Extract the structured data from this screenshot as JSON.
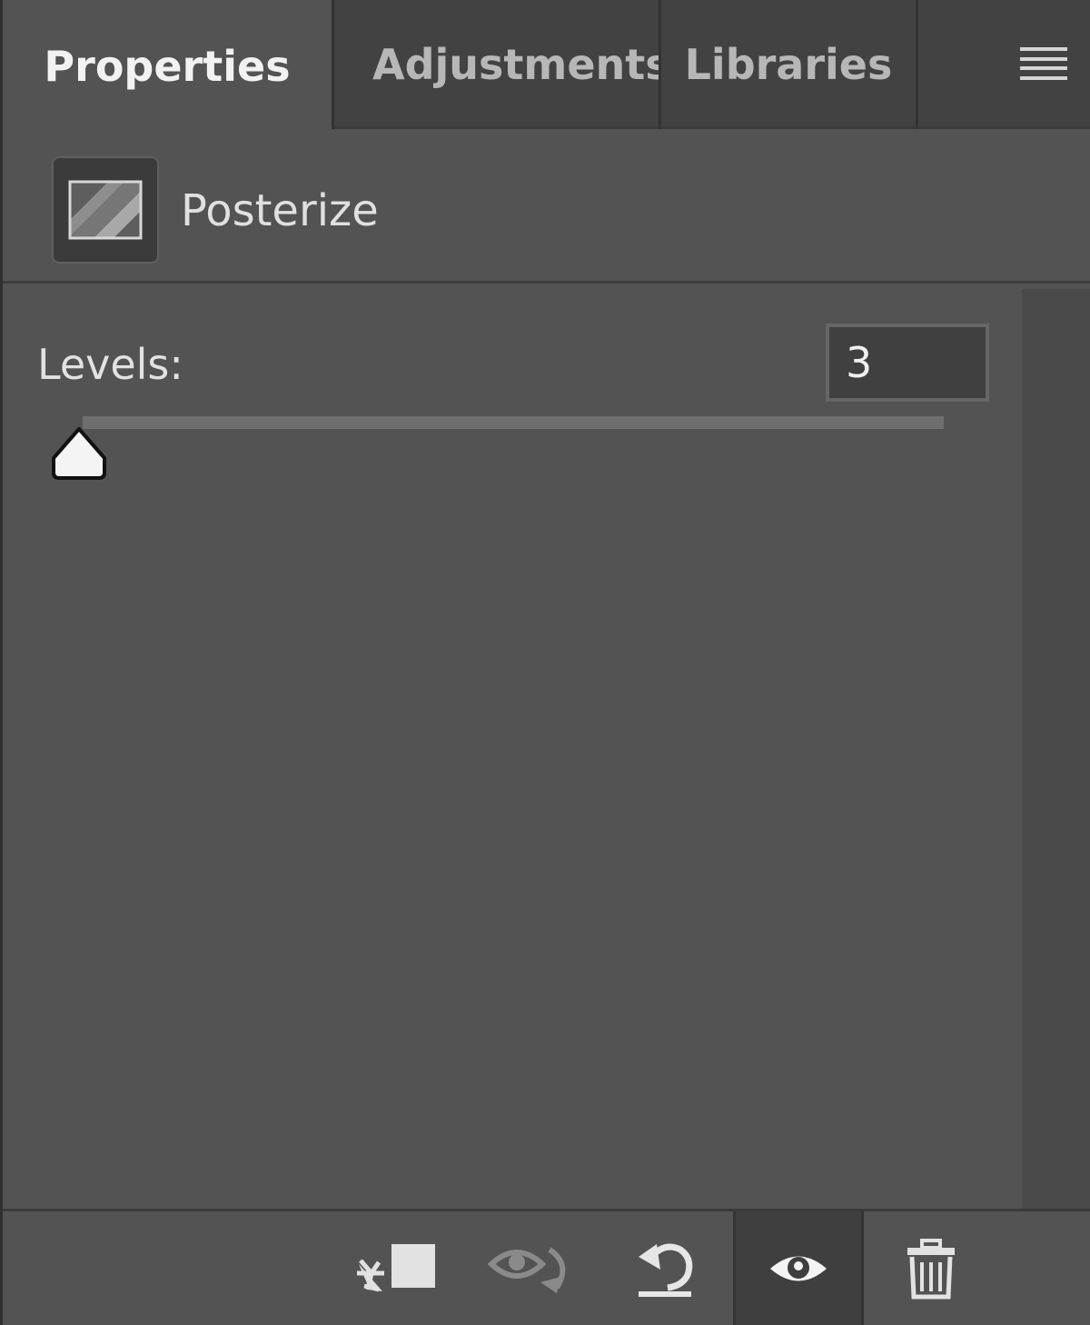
{
  "tabs": [
    {
      "label": "Properties",
      "active": true
    },
    {
      "label": "Adjustments",
      "active": false
    },
    {
      "label": "Libraries",
      "active": false
    }
  ],
  "panel_menu_icon": "hamburger-menu-icon",
  "header": {
    "icon": "posterize-adjustment-icon",
    "title": "Posterize"
  },
  "levels": {
    "label": "Levels:",
    "value": "3",
    "slider_min": 2,
    "slider_max": 255,
    "slider_value": 3
  },
  "footer_icons": [
    "clip-to-layer-icon",
    "view-previous-state-icon",
    "reset-icon",
    "toggle-visibility-icon",
    "delete-icon"
  ],
  "colors": {
    "panel_bg": "#535353",
    "tab_bar_bg": "#424242",
    "active_tab_text": "#f2f2f2",
    "inactive_tab_text": "#b7b7b7"
  }
}
